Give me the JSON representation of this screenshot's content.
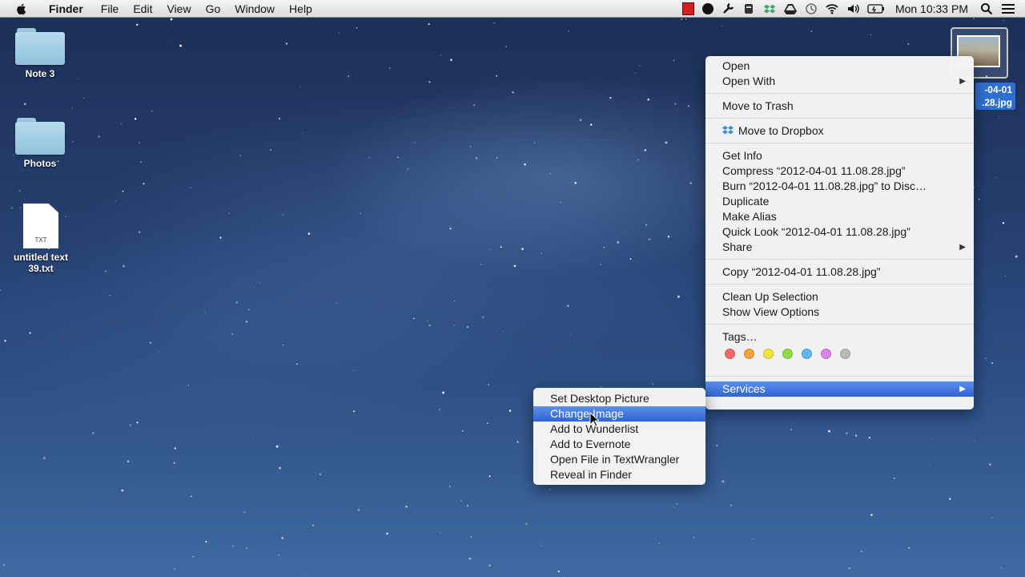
{
  "menubar": {
    "apple_icon": "apple-logo-icon",
    "app_name": "Finder",
    "items": [
      "File",
      "Edit",
      "View",
      "Go",
      "Window",
      "Help"
    ],
    "status_icons": [
      "red-app-icon",
      "evernote-icon",
      "wrench-icon",
      "notification-icon",
      "dropbox-icon",
      "google-drive-icon",
      "time-machine-icon",
      "wifi-icon",
      "volume-icon",
      "battery-icon"
    ],
    "clock": "Mon 10:33 PM"
  },
  "desktop": {
    "icons": [
      {
        "label": "Note 3",
        "type": "folder"
      },
      {
        "label": "Photos",
        "type": "folder"
      },
      {
        "label_line1": "untitled text",
        "label_line2": "39.txt",
        "type": "txt",
        "badge": "TXT"
      }
    ],
    "selected_file": {
      "label_line1": "-04-01",
      "label_line2": ".28.jpg"
    }
  },
  "context_menu": {
    "open": "Open",
    "open_with": "Open With",
    "move_to_trash": "Move to Trash",
    "move_to_dropbox": "Move to Dropbox",
    "get_info": "Get Info",
    "compress": "Compress “2012-04-01 11.08.28.jpg”",
    "burn": "Burn “2012-04-01 11.08.28.jpg” to Disc…",
    "duplicate": "Duplicate",
    "make_alias": "Make Alias",
    "quick_look": "Quick Look “2012-04-01 11.08.28.jpg”",
    "share": "Share",
    "copy": "Copy “2012-04-01 11.08.28.jpg”",
    "clean_up": "Clean Up Selection",
    "show_view_options": "Show View Options",
    "tags": "Tags…",
    "tag_colors": [
      "#f26a6a",
      "#f5a33b",
      "#f2e23a",
      "#8fdc45",
      "#5fb8f0",
      "#d983e8",
      "#b9b9b9"
    ],
    "services": "Services"
  },
  "services_menu": {
    "items": [
      "Set Desktop Picture",
      "Change Image",
      "Add to Wunderlist",
      "Add to Evernote",
      "Open File in TextWrangler",
      "Reveal in Finder"
    ]
  },
  "colors": {
    "highlight": "#2f64d8"
  }
}
